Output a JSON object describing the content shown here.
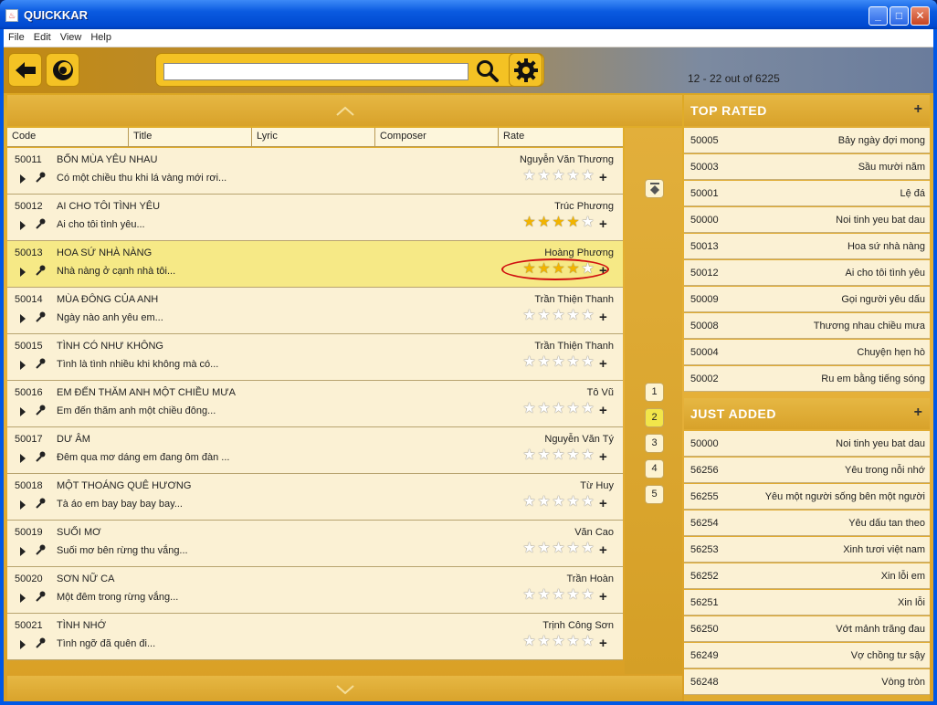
{
  "window": {
    "title": "QUICKKAR"
  },
  "menu": [
    "File",
    "Edit",
    "View",
    "Help"
  ],
  "search": {
    "placeholder": "",
    "value": ""
  },
  "result_count": "12 - 22 out of 6225",
  "columns": [
    "Code",
    "Title",
    "Lyric",
    "Composer",
    "Rate"
  ],
  "songs": [
    {
      "code": "50011",
      "title": "BỐN MÙA YÊU NHAU",
      "lyric": "Có một chiều thu khi lá vàng mới rơi...",
      "composer": "Nguyễn Văn Thương",
      "rating": 0,
      "selected": false
    },
    {
      "code": "50012",
      "title": "AI CHO TÔI TÌNH YÊU",
      "lyric": "Ai cho tôi tình yêu...",
      "composer": "Trúc Phương",
      "rating": 4,
      "selected": false
    },
    {
      "code": "50013",
      "title": "HOA SỨ NHÀ NÀNG",
      "lyric": "Nhà nàng ở cạnh nhà tôi...",
      "composer": "Hoàng Phương",
      "rating": 4,
      "selected": true
    },
    {
      "code": "50014",
      "title": "MÙA ĐÔNG CỦA ANH",
      "lyric": "Ngày nào anh yêu em...",
      "composer": "Trần Thiện Thanh",
      "rating": 0,
      "selected": false
    },
    {
      "code": "50015",
      "title": "TÌNH CÓ NHƯ KHÔNG",
      "lyric": "Tình là tình nhiều khi không mà có...",
      "composer": "Trần Thiện Thanh",
      "rating": 0,
      "selected": false
    },
    {
      "code": "50016",
      "title": "EM ĐẾN THĂM ANH MỘT CHIỀU MƯA",
      "lyric": "Em đến thăm anh một chiều đông...",
      "composer": "Tô Vũ",
      "rating": 0,
      "selected": false
    },
    {
      "code": "50017",
      "title": "DƯ ÂM",
      "lyric": "Đêm qua mơ dáng em đang ôm đàn ...",
      "composer": "Nguyễn Văn Tý",
      "rating": 0,
      "selected": false
    },
    {
      "code": "50018",
      "title": "MỘT THOÁNG QUÊ HƯƠNG",
      "lyric": "Tà áo em bay bay bay bay...",
      "composer": "Từ Huy",
      "rating": 0,
      "selected": false
    },
    {
      "code": "50019",
      "title": "SUỐI MƠ",
      "lyric": "Suối mơ bên rừng thu vắng...",
      "composer": "Văn Cao",
      "rating": 0,
      "selected": false
    },
    {
      "code": "50020",
      "title": "SƠN NỮ CA",
      "lyric": "Một đêm trong rừng vắng...",
      "composer": "Trần Hoàn",
      "rating": 0,
      "selected": false
    },
    {
      "code": "50021",
      "title": "TÌNH NHỚ",
      "lyric": "Tình ngỡ đã quên đi...",
      "composer": "Trịnh Công Sơn",
      "rating": 0,
      "selected": false
    }
  ],
  "pages": [
    "1",
    "2",
    "3",
    "4",
    "5"
  ],
  "current_page": "2",
  "top_rated": {
    "title": "TOP RATED",
    "items": [
      {
        "code": "50005",
        "title": "Bảy ngày đợi mong"
      },
      {
        "code": "50003",
        "title": "Sầu mười năm"
      },
      {
        "code": "50001",
        "title": "Lệ đá"
      },
      {
        "code": "50000",
        "title": "Noi tinh yeu bat dau"
      },
      {
        "code": "50013",
        "title": "Hoa sứ nhà nàng"
      },
      {
        "code": "50012",
        "title": "Ai cho tôi tình yêu"
      },
      {
        "code": "50009",
        "title": "Gọi người yêu dấu"
      },
      {
        "code": "50008",
        "title": "Thương nhau chiều mưa"
      },
      {
        "code": "50004",
        "title": "Chuyện hẹn hò"
      },
      {
        "code": "50002",
        "title": "Ru em bằng tiếng sóng"
      }
    ]
  },
  "just_added": {
    "title": "JUST ADDED",
    "items": [
      {
        "code": "50000",
        "title": "Noi tinh yeu bat dau"
      },
      {
        "code": "56256",
        "title": "Yêu trong nỗi nhớ"
      },
      {
        "code": "56255",
        "title": "Yêu một người sống bên một người"
      },
      {
        "code": "56254",
        "title": "Yêu dấu tan theo"
      },
      {
        "code": "56253",
        "title": "Xinh tươi việt nam"
      },
      {
        "code": "56252",
        "title": "Xin lỗi em"
      },
      {
        "code": "56251",
        "title": "Xin lỗi"
      },
      {
        "code": "56250",
        "title": "Vớt mảnh trăng đau"
      },
      {
        "code": "56249",
        "title": "Vợ chồng tư sậy"
      },
      {
        "code": "56248",
        "title": "Vòng tròn"
      }
    ]
  },
  "colors": {
    "accent": "#f4c224",
    "selected_row": "#f6e986",
    "row_bg": "#fbf1d4",
    "star": "#f2b400",
    "highlight_ring": "#d01010"
  },
  "icons": [
    "back-arrow-icon",
    "moon-icon",
    "search-icon",
    "gear-icon",
    "chevron-up-icon",
    "chevron-down-icon",
    "play-icon",
    "microphone-icon",
    "star-icon",
    "plus-icon",
    "page-top-icon",
    "page-bottom-icon"
  ]
}
